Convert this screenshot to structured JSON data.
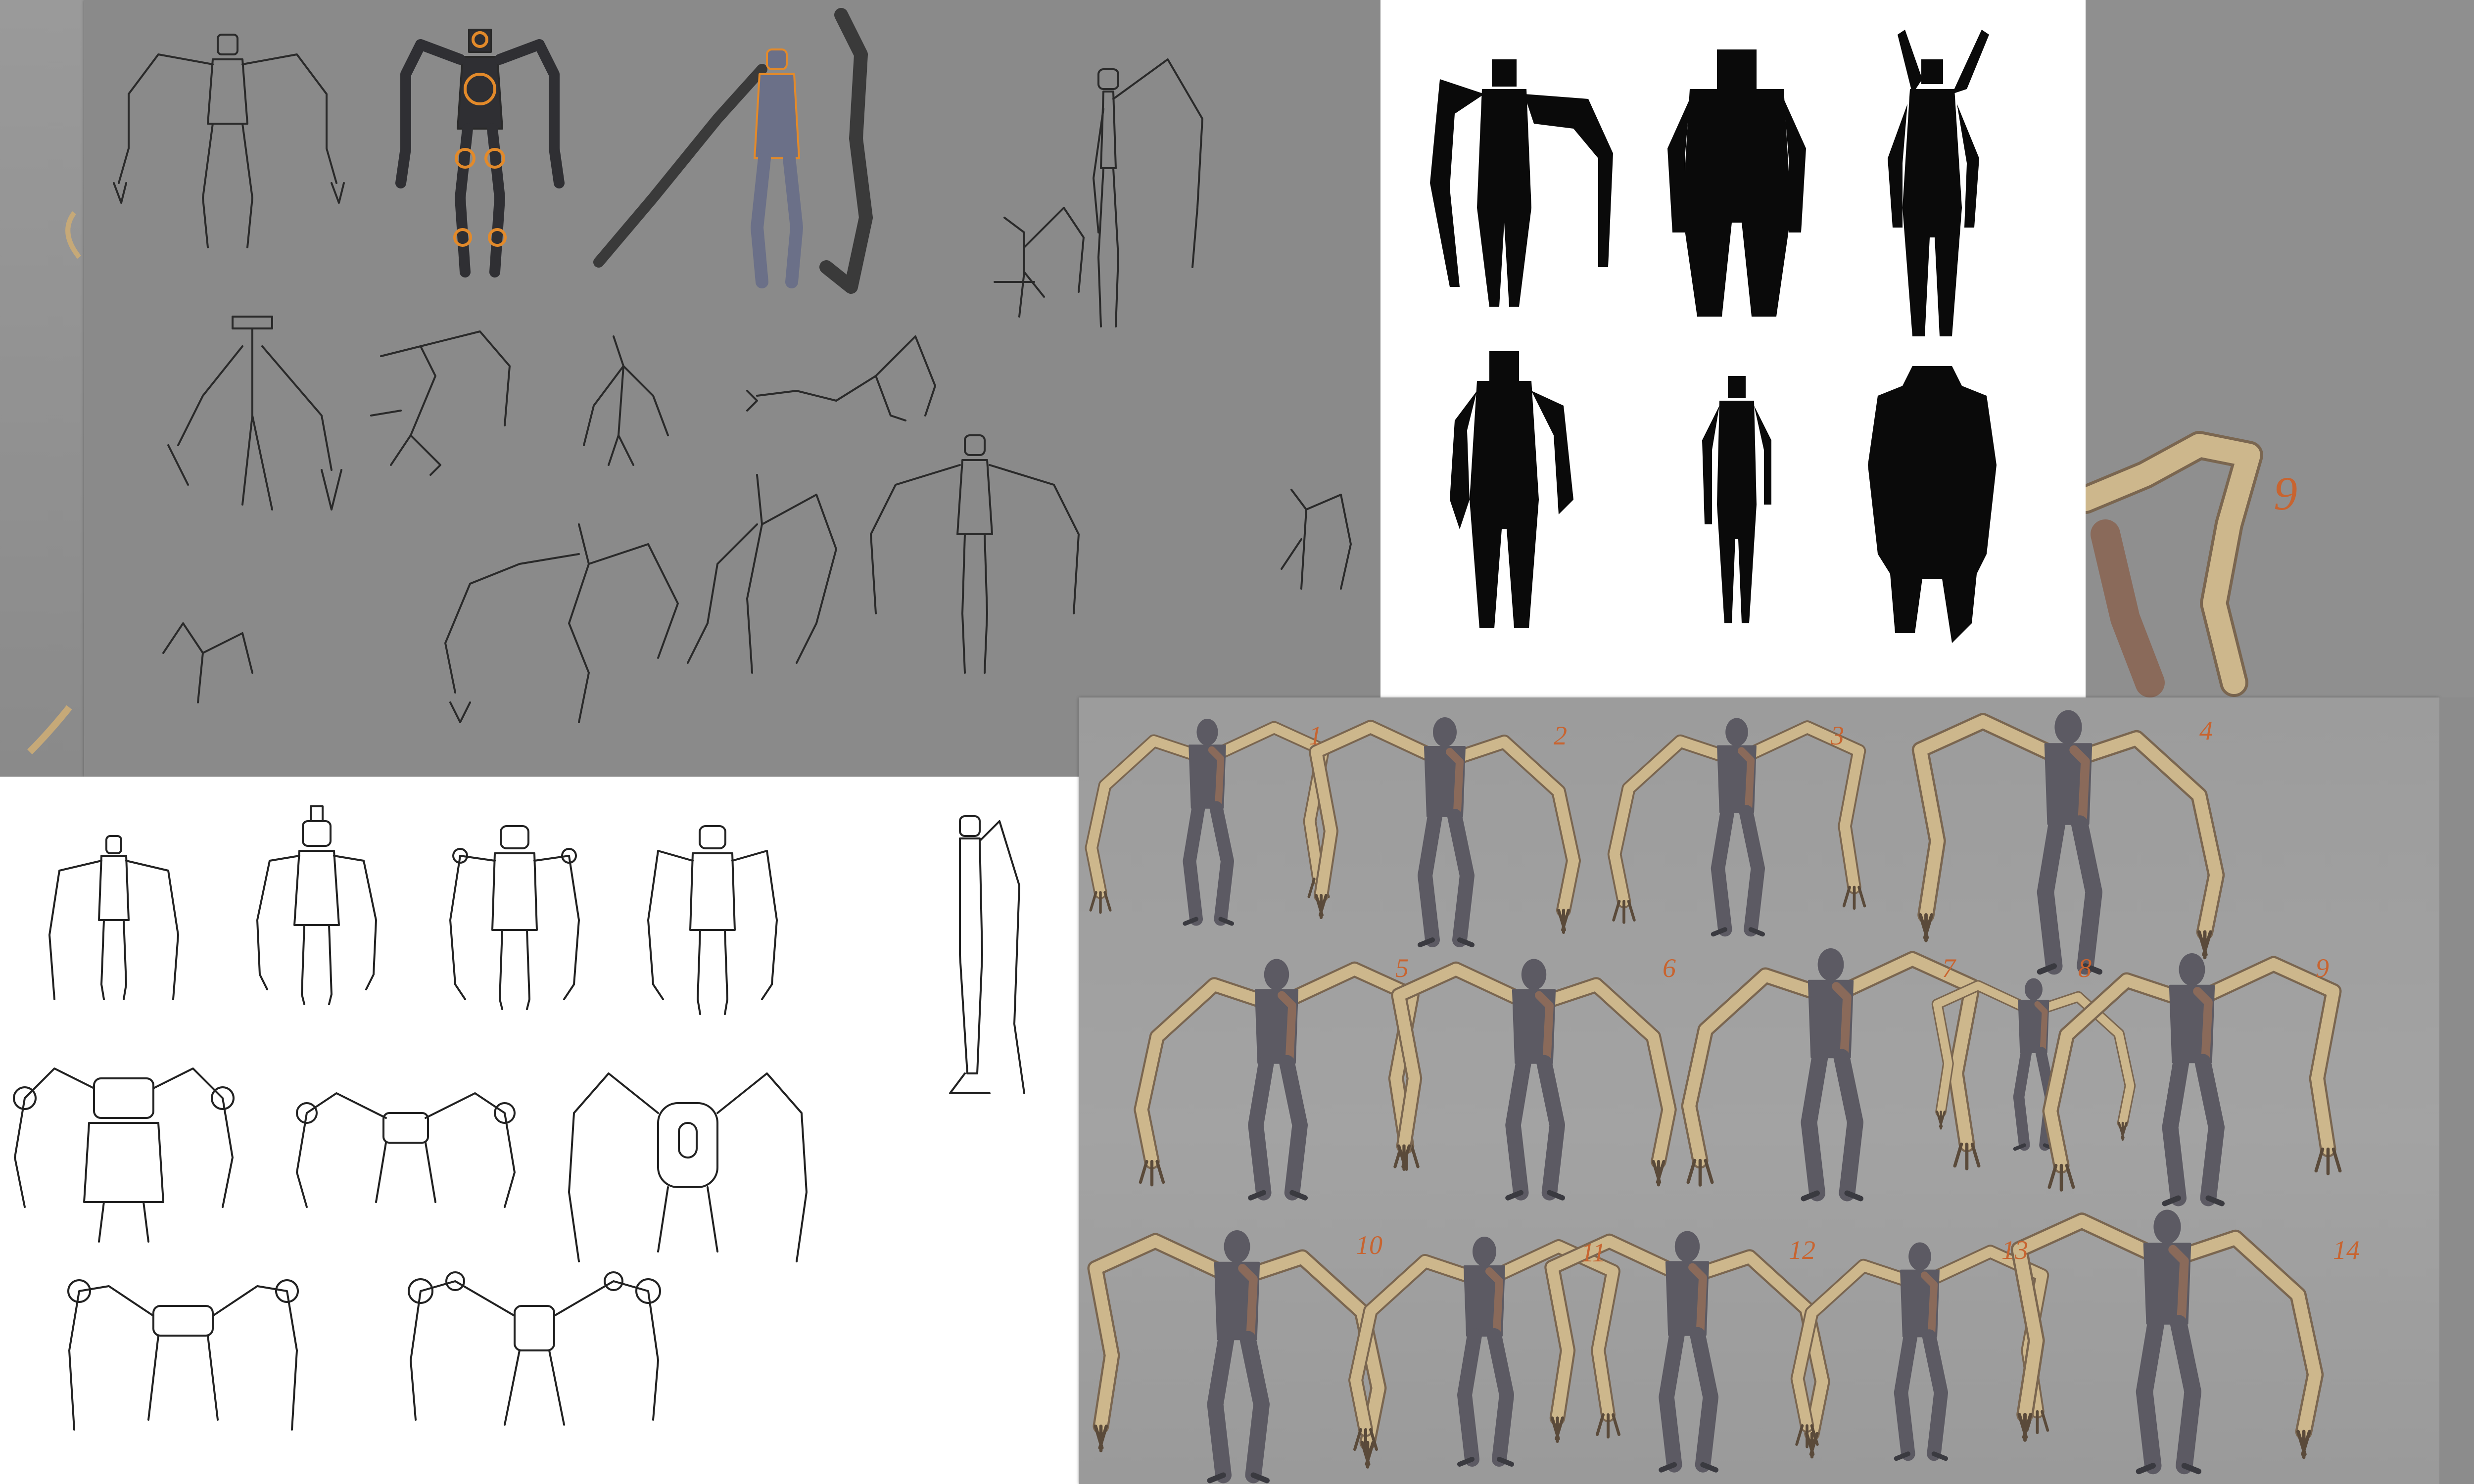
{
  "colors": {
    "number_orange": "#c86430",
    "limb_tan": "#cdb78c",
    "body_dark": "#5c5a63",
    "body_brown": "#8a6a5a",
    "accent_orange": "#e38a2a",
    "ink": "#1e1e1e"
  },
  "variant_labels": [
    "1",
    "2",
    "3",
    "4",
    "5",
    "6",
    "7",
    "8",
    "9",
    "10",
    "11",
    "12",
    "13",
    "14"
  ],
  "side_label": "9"
}
